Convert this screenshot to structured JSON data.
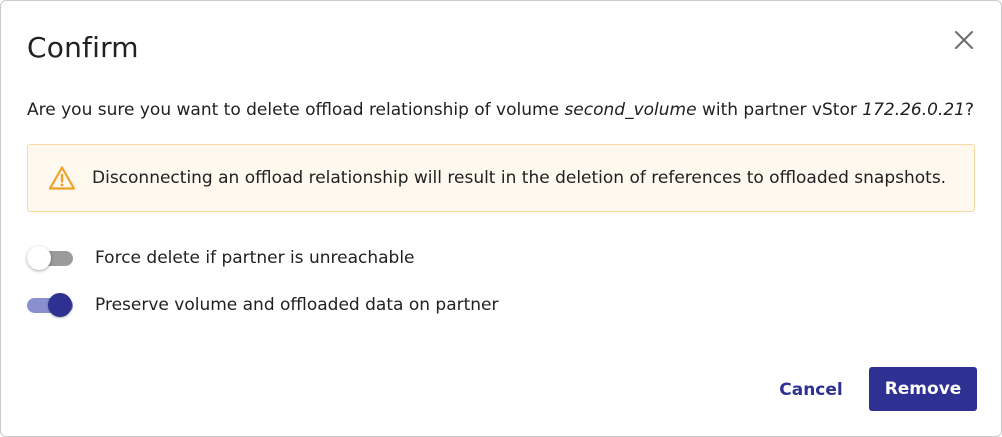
{
  "dialog": {
    "title": "Confirm",
    "close_icon": "close-icon",
    "message": {
      "prefix": "Are you sure you want to delete offload relationship of volume ",
      "volume": "second_volume",
      "middle": " with partner vStor ",
      "partner_ip": "172.26.0.21",
      "suffix": "?"
    },
    "warning": {
      "icon": "warning-triangle-icon",
      "text": "Disconnecting an offload relationship will result in the deletion of references to offloaded snapshots.",
      "background": "#fff8ee",
      "border": "#f6d9a3",
      "icon_color": "#f0a12a"
    },
    "toggles": [
      {
        "label": "Force delete if partner is unreachable",
        "checked": false
      },
      {
        "label": "Preserve volume and offloaded data on partner",
        "checked": true
      }
    ],
    "actions": {
      "cancel_label": "Cancel",
      "remove_label": "Remove"
    },
    "accent_color": "#2e3192"
  }
}
